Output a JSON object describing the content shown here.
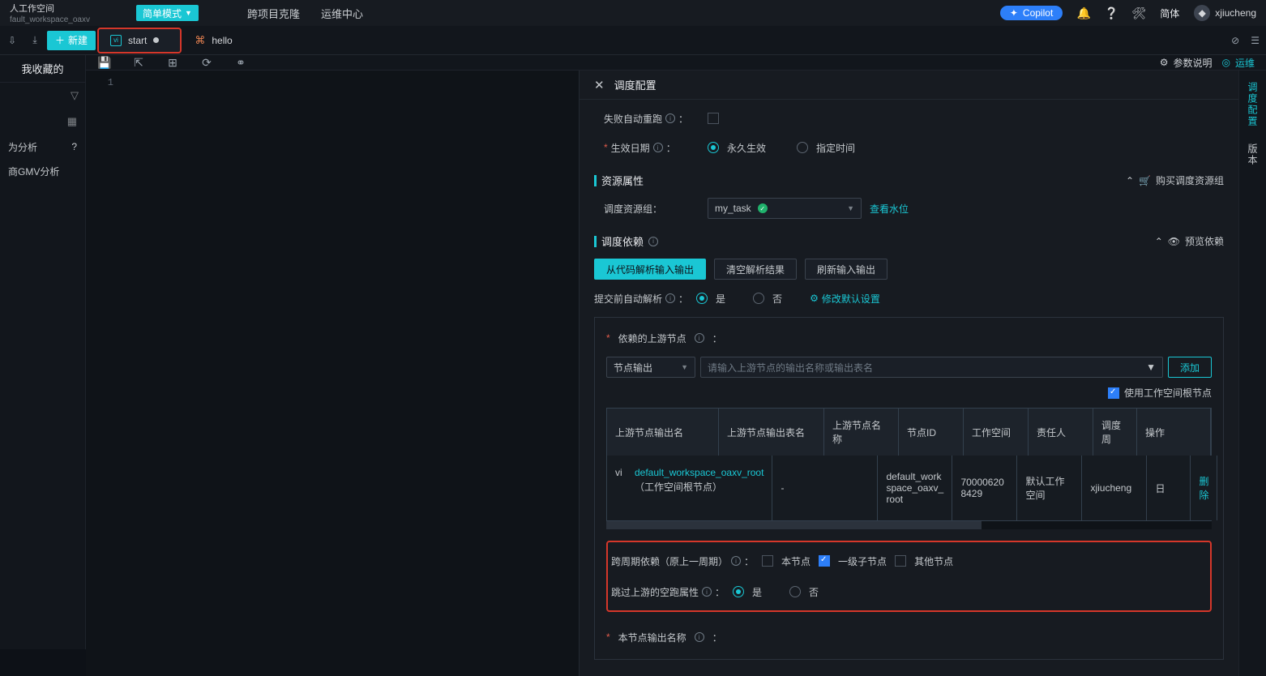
{
  "topbar": {
    "title_main": "人工作空间",
    "title_sub": "fault_workspace_oaxv",
    "mode_btn": "简单模式",
    "links": {
      "clone": "跨项目克隆",
      "ops": "运维中心"
    },
    "copilot": "Copilot",
    "lang": "简体",
    "user": "xjiucheng"
  },
  "tabs": {
    "new_btn": "新建",
    "start": {
      "label": "start",
      "icon": "vi"
    },
    "hello": {
      "label": "hello"
    }
  },
  "sidebar": {
    "fav": "我收藏的",
    "items": {
      "analysis": "为分析",
      "gmv": "商GMV分析"
    }
  },
  "iconbar": {
    "param_desc": "参数说明",
    "ops": "运维"
  },
  "editor": {
    "line1": "1"
  },
  "panel": {
    "header": "调度配置",
    "retry_label": "失败自动重跑",
    "effective_label": "生效日期",
    "effective_radios": {
      "forever": "永久生效",
      "range": "指定时间"
    },
    "resource": {
      "title": "资源属性",
      "buy_link": "购买调度资源组",
      "group_label": "调度资源组：",
      "group_value": "my_task",
      "view_water": "查看水位"
    },
    "dep": {
      "title": "调度依赖",
      "preview": "预览依赖",
      "btn_parse": "从代码解析输入输出",
      "btn_clear": "清空解析结果",
      "btn_refresh": "刷新输入输出",
      "auto_label": "提交前自动解析",
      "yes": "是",
      "no": "否",
      "modify_link": "修改默认设置",
      "upstream_label": "依赖的上游节点",
      "select_placeholder": "节点输出",
      "input_placeholder": "请输入上游节点的输出名称或输出表名",
      "add_btn": "添加",
      "root_checkbox": "使用工作空间根节点",
      "table": {
        "cols": {
          "c1": "上游节点输出名",
          "c2": "上游节点输出表名",
          "c3": "上游节点名称",
          "c4": "节点ID",
          "c5": "工作空间",
          "c6": "责任人",
          "c7": "调度周",
          "c8": "操作"
        },
        "row": {
          "out_name_link": "default_workspace_oaxv_root",
          "out_name_sub": "（工作空间根节点）",
          "out_table": "-",
          "node_name": "default_workspace_oaxv_root",
          "node_id": "700006208429",
          "workspace": "默认工作空间",
          "owner": "xjiucheng",
          "cycle": "日",
          "action": "删除"
        }
      },
      "cross_label": "跨周期依赖（原上一周期）",
      "cross_self": "本节点",
      "cross_child": "一级子节点",
      "cross_other": "其他节点",
      "skip_label": "跳过上游的空跑属性"
    },
    "out_name_title": "本节点输出名称"
  },
  "rightrail": {
    "sched": "调度配置",
    "version": "版本"
  }
}
